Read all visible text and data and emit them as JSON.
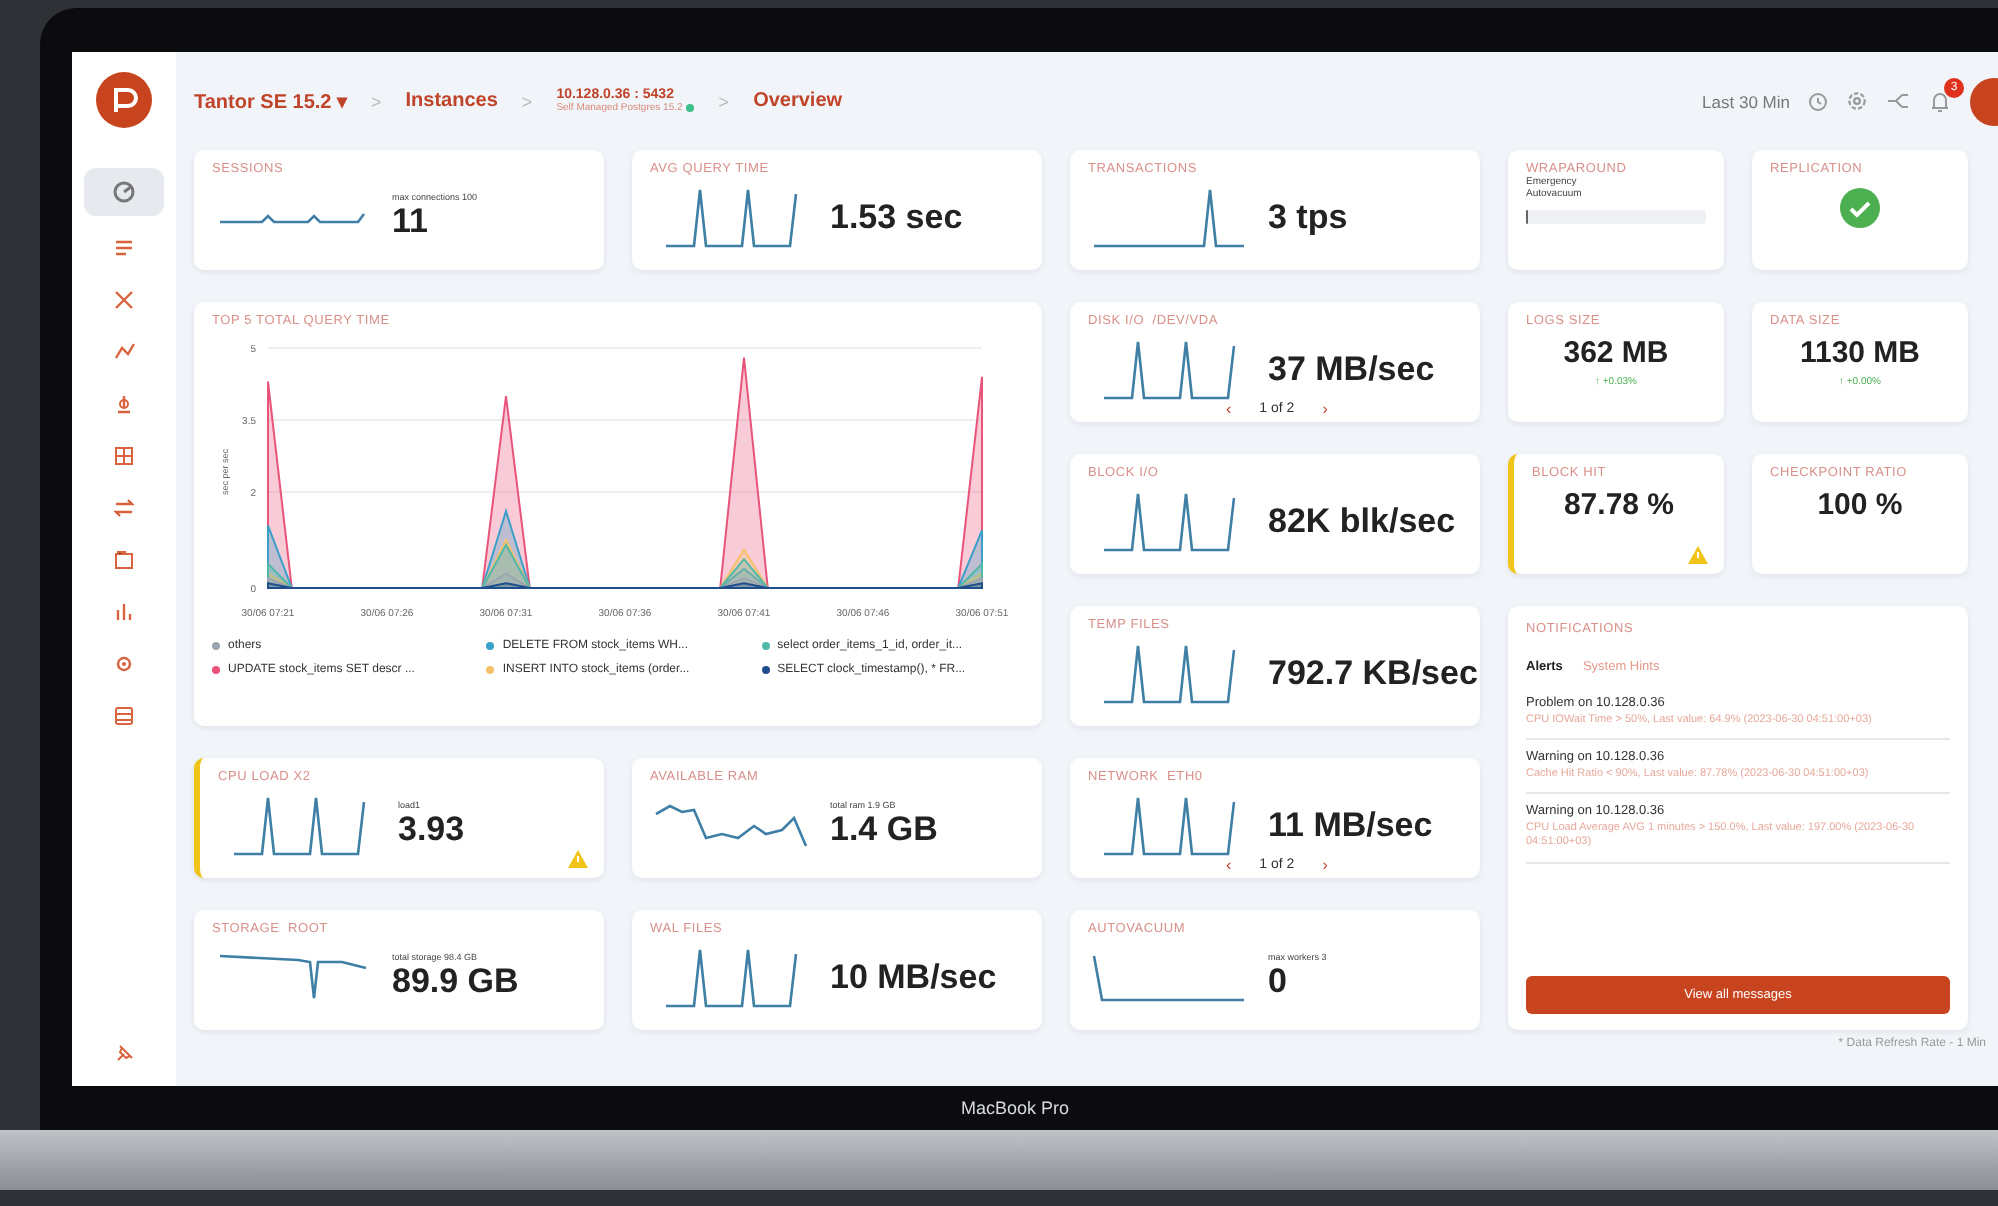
{
  "header": {
    "breadcrumbs": [
      {
        "kind": "dropdown",
        "label": "Tantor SE 15.2",
        "caret": "▾"
      },
      {
        "kind": "link",
        "label": "Instances"
      },
      {
        "kind": "instance",
        "label": "10.128.0.36 : 5432",
        "sublabel": "Self Managed Postgres 15.2",
        "online": true
      },
      {
        "kind": "current",
        "label": "Overview"
      }
    ],
    "separator": ">",
    "time_range": "Last 30 Min",
    "notification_count": "3"
  },
  "sidebar": {
    "items": [
      {
        "selected": true
      },
      {
        "selected": false
      },
      {
        "selected": false
      },
      {
        "selected": false
      },
      {
        "selected": false
      },
      {
        "selected": false
      },
      {
        "selected": false
      },
      {
        "selected": false
      },
      {
        "selected": false
      },
      {
        "selected": false
      },
      {
        "selected": false
      }
    ]
  },
  "panels": [
    {
      "kind": "metric",
      "title": "SESSIONS",
      "caption": "max connections 100",
      "value": "11",
      "warning": false
    },
    {
      "kind": "metric",
      "title": "AVG QUERY TIME",
      "value": "1.53 sec",
      "warning": false
    },
    {
      "kind": "metric",
      "title": "TRANSACTIONS",
      "value": "3 tps",
      "warning": false
    },
    {
      "kind": "gauge",
      "title": "WRAPAROUND",
      "labels": [
        "Emergency",
        "Autovacuum"
      ],
      "level": 0.01
    },
    {
      "kind": "status",
      "title": "REPLICATION"
    },
    {
      "kind": "chart",
      "title": "TOP 5 TOTAL QUERY TIME",
      "chart_data": {
        "type": "area",
        "ylabel": "sec per sec",
        "categories": [
          "30/06 07:21",
          null,
          null,
          null,
          null,
          "30/06 07:26",
          null,
          null,
          null,
          null,
          "30/06 07:31",
          null,
          null,
          null,
          null,
          "30/06 07:36",
          null,
          null,
          null,
          null,
          "30/06 07:41",
          null,
          null,
          null,
          null,
          "30/06 07:46",
          null,
          null,
          null,
          null,
          "30/06 07:51"
        ],
        "yticks": [
          0,
          2,
          3.5,
          5
        ],
        "ylim": [
          0,
          5
        ],
        "series": [
          {
            "name": "others",
            "color": "#9aa5b1",
            "values": [
              0.2,
              0,
              0,
              0,
              0,
              0,
              0,
              0,
              0,
              0,
              0.3,
              0,
              0,
              0,
              0,
              0,
              0,
              0,
              0,
              0,
              0.2,
              0,
              0,
              0,
              0,
              0,
              0,
              0,
              0,
              0,
              0.2
            ]
          },
          {
            "name": "DELETE FROM stock_items WH...",
            "color": "#3aa0c8",
            "values": [
              1.3,
              0,
              0,
              0,
              0,
              0,
              0,
              0,
              0,
              0,
              1.6,
              0,
              0,
              0,
              0,
              0,
              0,
              0,
              0,
              0,
              0.4,
              0,
              0,
              0,
              0,
              0,
              0,
              0,
              0,
              0,
              1.2
            ]
          },
          {
            "name": "select order_items_1_id, order_it...",
            "color": "#4fb8a8",
            "values": [
              0.5,
              0,
              0,
              0,
              0,
              0,
              0,
              0,
              0,
              0,
              0.9,
              0,
              0,
              0,
              0,
              0,
              0,
              0,
              0,
              0,
              0.6,
              0,
              0,
              0,
              0,
              0,
              0,
              0,
              0,
              0,
              0.5
            ]
          },
          {
            "name": "UPDATE stock_items SET descr ...",
            "color": "#e8547a",
            "values": [
              4.3,
              0,
              0,
              0,
              0,
              0,
              0,
              0,
              0,
              0,
              4.0,
              0,
              0,
              0,
              0,
              0,
              0,
              0,
              0,
              0,
              4.8,
              0,
              0,
              0,
              0,
              0,
              0,
              0,
              0,
              0,
              4.4
            ]
          },
          {
            "name": "INSERT INTO stock_items (order...",
            "color": "#f5c26b",
            "values": [
              0.3,
              0,
              0,
              0,
              0,
              0,
              0,
              0,
              0,
              0,
              1.0,
              0,
              0,
              0,
              0,
              0,
              0,
              0,
              0,
              0,
              0.8,
              0,
              0,
              0,
              0,
              0,
              0,
              0,
              0,
              0,
              0.3
            ]
          },
          {
            "name": "SELECT clock_timestamp(), * FR...",
            "color": "#1f4e8c",
            "values": [
              0.1,
              0,
              0,
              0,
              0,
              0,
              0,
              0,
              0,
              0,
              0.1,
              0,
              0,
              0,
              0,
              0,
              0,
              0,
              0,
              0,
              0.1,
              0,
              0,
              0,
              0,
              0,
              0,
              0,
              0,
              0,
              0.1
            ]
          }
        ]
      }
    },
    {
      "kind": "metric",
      "title": "DISK I/O  /DEV/VDA",
      "value": "37 MB/sec",
      "pager": {
        "prev": "‹",
        "label": "1 of 2",
        "next": "›"
      },
      "warning": false
    },
    {
      "kind": "stat",
      "title": "LOGS SIZE",
      "value": "362 MB",
      "delta": "↑ +0.03%",
      "warning": false
    },
    {
      "kind": "stat",
      "title": "DATA SIZE",
      "value": "1130 MB",
      "delta": "↑ +0.00%",
      "warning": false
    },
    {
      "kind": "metric",
      "title": "BLOCK I/O",
      "value": "82K blk/sec",
      "warning": false
    },
    {
      "kind": "stat",
      "title": "BLOCK HIT",
      "value": "87.78 %",
      "warning": true
    },
    {
      "kind": "stat",
      "title": "CHECKPOINT RATIO",
      "value": "100 %",
      "warning": false
    },
    {
      "kind": "metric",
      "title": "TEMP FILES",
      "value": "792.7 KB/sec",
      "warning": false
    },
    {
      "kind": "notifications",
      "title": "NOTIFICATIONS",
      "tabs": [
        {
          "label": "Alerts",
          "selected": true
        },
        {
          "label": "System Hints",
          "selected": false
        }
      ],
      "items": [
        {
          "heading": "Problem on 10.128.0.36",
          "detail": "CPU IOWait Time > 50%, Last value: 64.9% (2023-06-30 04:51:00+03)"
        },
        {
          "heading": "Warning on 10.128.0.36",
          "detail": "Cache Hit Ratio < 90%, Last value: 87.78% (2023-06-30 04:51:00+03)"
        },
        {
          "heading": "Warning on 10.128.0.36",
          "detail": "CPU Load Average AVG 1 minutes > 150.0%, Last value: 197.00% (2023-06-30 04:51:00+03)"
        }
      ],
      "button": "View all messages"
    },
    {
      "kind": "metric",
      "title": "CPU LOAD X2",
      "caption": "load1",
      "value": "3.93",
      "warning": true
    },
    {
      "kind": "metric",
      "title": "AVAILABLE RAM",
      "caption": "total ram 1.9 GB",
      "value": "1.4 GB",
      "warning": false
    },
    {
      "kind": "metric",
      "title": "NETWORK  ETH0",
      "value": "11 MB/sec",
      "pager": {
        "prev": "‹",
        "label": "1 of 2",
        "next": "›"
      },
      "warning": false
    },
    {
      "kind": "metric",
      "title": "STORAGE  ROOT",
      "caption": "total storage 98.4 GB",
      "value": "89.9 GB",
      "warning": false
    },
    {
      "kind": "metric",
      "title": "WAL FILES",
      "value": "10 MB/sec",
      "warning": false
    },
    {
      "kind": "metric",
      "title": "AUTOVACUUM",
      "caption": "max workers 3",
      "value": "0",
      "warning": false
    }
  ],
  "footnote": "* Data Refresh Rate - 1 Min",
  "device_label": "MacBook Pro"
}
